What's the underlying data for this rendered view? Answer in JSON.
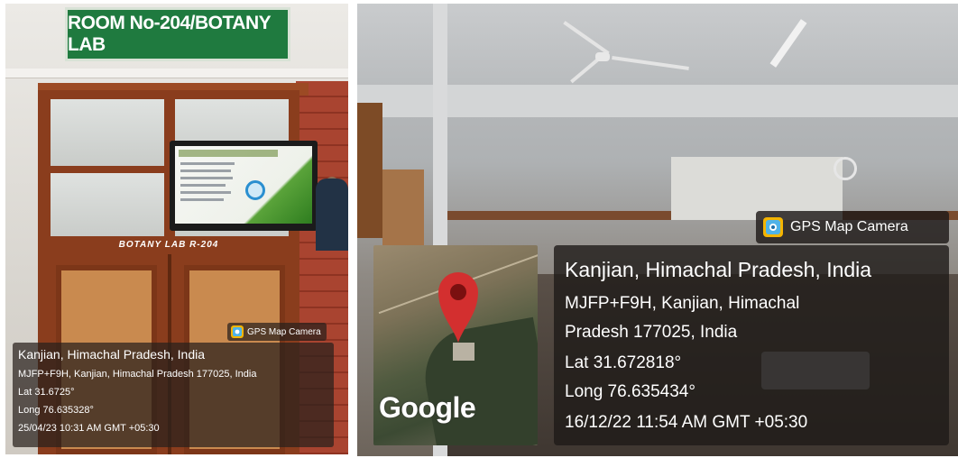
{
  "left_photo": {
    "sign_text": "ROOM No-204/BOTANY LAB",
    "door_label": "BOTANY LAB R-204",
    "badge": {
      "icon": "gps-camera-icon",
      "text": "GPS Map Camera"
    },
    "overlay": {
      "title": "Kanjian, Himachal Pradesh, India",
      "address": "MJFP+F9H, Kanjian, Himachal Pradesh 177025, India",
      "lat": "Lat 31.6725°",
      "long": "Long 76.635328°",
      "datetime": "25/04/23 10:31 AM GMT +05:30"
    }
  },
  "right_photo": {
    "badge": {
      "icon": "gps-camera-icon",
      "text": "GPS Map Camera"
    },
    "map": {
      "watermark": "Google",
      "marker": "location-pin-icon",
      "marker_color": "#d32f2f"
    },
    "overlay": {
      "title": "Kanjian, Himachal Pradesh, India",
      "address_line1": "MJFP+F9H, Kanjian, Himachal",
      "address_line2": "Pradesh 177025, India",
      "lat": "Lat 31.672818°",
      "long": "Long 76.635434°",
      "datetime": "16/12/22 11:54 AM GMT +05:30"
    }
  }
}
